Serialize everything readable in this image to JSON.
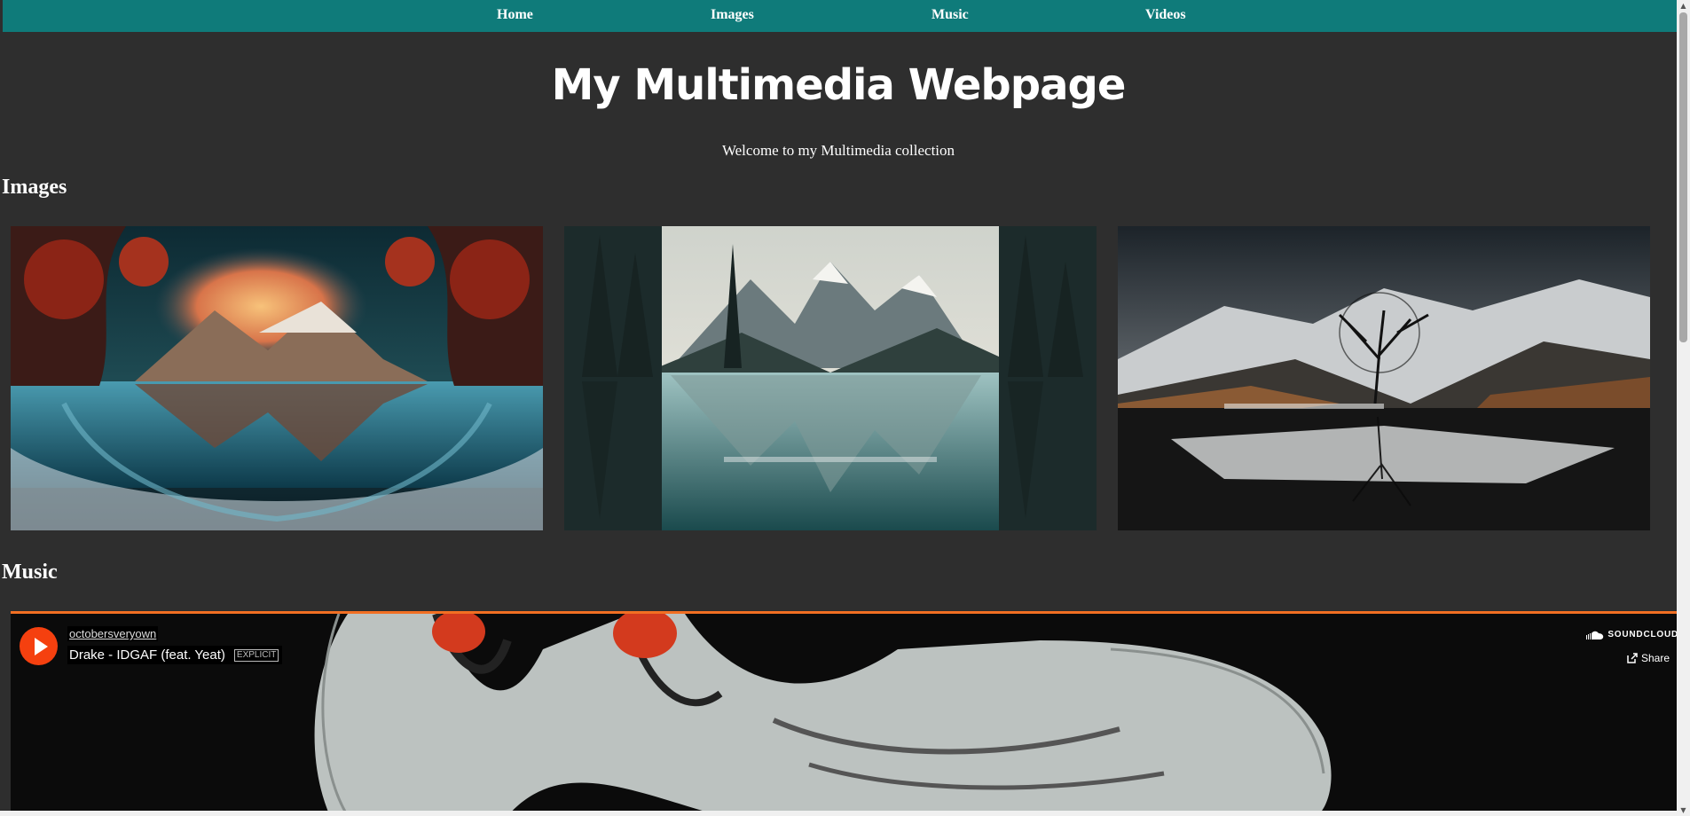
{
  "nav": {
    "items": [
      "Home",
      "Images",
      "Music",
      "Videos"
    ]
  },
  "header": {
    "title": "My Multimedia Webpage",
    "subtitle": "Welcome to my Multimedia collection"
  },
  "images_section": {
    "heading": "Images",
    "images": [
      "forest lake reflection sunset",
      "mountain lake forest reflection",
      "snowy mountains lone tree lake"
    ]
  },
  "music_section": {
    "heading": "Music"
  },
  "player": {
    "artist": "octobersveryown",
    "track": "Drake - IDGAF (feat. Yeat)",
    "explicit": "EXPLICIT",
    "brand": "SOUNDCLOUD",
    "share_label": "Share",
    "accent_color": "#f26f23",
    "play_color": "#f5400f"
  },
  "colors": {
    "nav_bg": "#0f7b7a",
    "page_bg": "#2e2e2e"
  }
}
